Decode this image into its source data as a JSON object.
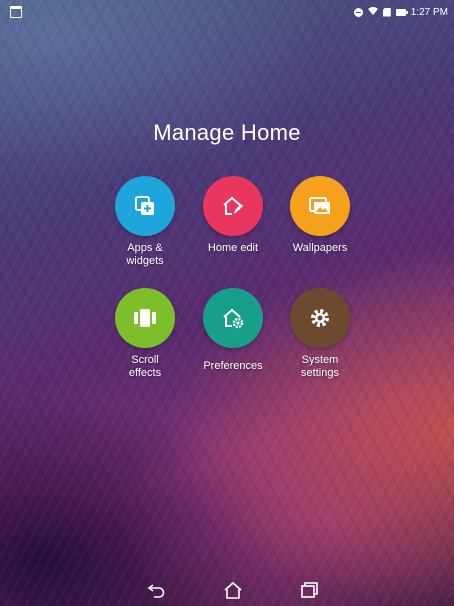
{
  "status_bar": {
    "left_icon": "gallery-notification-icon",
    "icons": [
      "do-not-disturb-icon",
      "wifi-icon",
      "sim-icon",
      "battery-icon"
    ],
    "time": "1:27 PM"
  },
  "title": "Manage Home",
  "items": [
    {
      "line1": "Apps &",
      "line2": "widgets",
      "icon": "apps-widgets-icon",
      "color": "#1ea5dc"
    },
    {
      "line1": "Home edit",
      "line2": "",
      "icon": "home-edit-icon",
      "color": "#e8365f"
    },
    {
      "line1": "Wallpapers",
      "line2": "",
      "icon": "wallpapers-icon",
      "color": "#f5a11b"
    },
    {
      "line1": "Scroll",
      "line2": "effects",
      "icon": "scroll-effects-icon",
      "color": "#7dbf2a"
    },
    {
      "line1": "Preferences",
      "line2": "",
      "icon": "preferences-icon",
      "color": "#179f8c"
    },
    {
      "line1": "System",
      "line2": "settings",
      "icon": "system-settings-icon",
      "color": "#6b4a30"
    }
  ],
  "nav": [
    "back-icon",
    "home-icon",
    "recents-icon"
  ]
}
